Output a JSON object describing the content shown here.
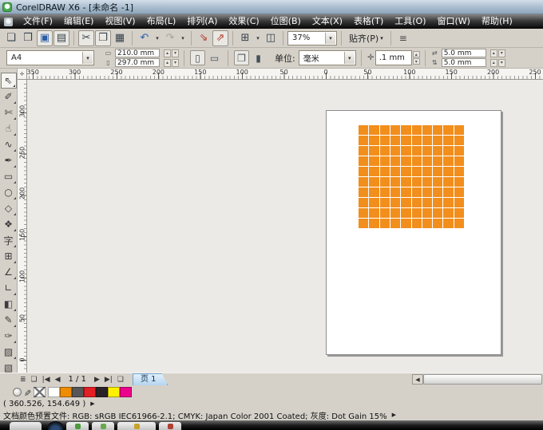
{
  "window": {
    "title": "CorelDRAW X6 - [未命名 -1]"
  },
  "menu": {
    "items": [
      "文件(F)",
      "编辑(E)",
      "视图(V)",
      "布局(L)",
      "排列(A)",
      "效果(C)",
      "位图(B)",
      "文本(X)",
      "表格(T)",
      "工具(O)",
      "窗口(W)",
      "帮助(H)"
    ]
  },
  "toolbar": {
    "new_glyph": "❏",
    "open_glyph": "❒",
    "save_glyph": "▣",
    "print_glyph": "▤",
    "cut_glyph": "✂",
    "copy_glyph": "❐",
    "paste_glyph": "▦",
    "undo_glyph": "↶",
    "redo_glyph": "↷",
    "import_glyph": "⇘",
    "export_glyph": "⇗",
    "launcher_glyph": "⊞",
    "welcome_glyph": "◫",
    "zoom_value": "37%",
    "snap_label": "贴齐(P)",
    "options_glyph": "≡"
  },
  "property_bar": {
    "page_size": "A4",
    "page_width": "210.0 mm",
    "page_height": "297.0 mm",
    "units_label": "单位:",
    "units_value": "毫米",
    "nudge_offset": ".1 mm",
    "duplicate_x": "5.0 mm",
    "duplicate_y": "5.0 mm"
  },
  "glyphs": {
    "spinner_up": "▴",
    "spinner_down": "▾",
    "dropdown": "▾",
    "flyout": "▶",
    "width_icon": "▭",
    "height_icon": "▯",
    "portrait_icon": "▯",
    "landscape_icon": "▭",
    "all_pages_icon": "❐",
    "single_page_icon": "▮",
    "nudge_icon": "✛",
    "dup_x_icon": "⇄",
    "dup_y_icon": "⇅",
    "ruler_origin_icon": "✛",
    "palette_eyedropper_icon": "✐",
    "page_list_icon": "≣",
    "add_page_icon": "❏",
    "first_page_icon": "|◀",
    "prev_page_icon": "◀",
    "next_page_icon": "▶",
    "last_page_icon": "▶|",
    "scroll_left_icon": "◀"
  },
  "rulers": {
    "horizontal_labels": [
      "350",
      "300",
      "250",
      "200",
      "150",
      "100",
      "50",
      "0",
      "50",
      "100",
      "150",
      "200",
      "250"
    ],
    "vertical_labels": [
      "300",
      "250",
      "200",
      "150",
      "100",
      "50",
      "0"
    ]
  },
  "toolbox": {
    "tools": [
      {
        "name": "pick-tool",
        "glyph": "⇖",
        "state": "selected"
      },
      {
        "name": "shape-tool",
        "glyph": "✐"
      },
      {
        "name": "crop-tool",
        "glyph": "✄"
      },
      {
        "name": "zoom-pan-tool",
        "glyph": "☝"
      },
      {
        "name": "freehand-tool",
        "glyph": "∿"
      },
      {
        "name": "smart-fill-tool",
        "glyph": "✒"
      },
      {
        "name": "rectangle-tool",
        "glyph": "▭"
      },
      {
        "name": "ellipse-tool",
        "glyph": "○"
      },
      {
        "name": "polygon-tool",
        "glyph": "◇"
      },
      {
        "name": "basic-shapes-tool",
        "glyph": "❖"
      },
      {
        "name": "text-tool",
        "glyph": "字"
      },
      {
        "name": "table-tool",
        "glyph": "⊞"
      },
      {
        "name": "dimension-tool",
        "glyph": "∠"
      },
      {
        "name": "connector-tool",
        "glyph": "∟"
      },
      {
        "name": "blend-tool",
        "glyph": "◧"
      },
      {
        "name": "color-eyedropper-tool",
        "glyph": "✎"
      },
      {
        "name": "outline-pen-tool",
        "glyph": "✑"
      },
      {
        "name": "fill-tool",
        "glyph": "▨"
      },
      {
        "name": "interactive-fill-tool",
        "glyph": "▧"
      }
    ]
  },
  "canvas": {
    "grid_object": {
      "rows": 10,
      "columns": 10,
      "fill_color": "#F28E1C",
      "line_color": "#FFFFFF"
    }
  },
  "page_nav": {
    "page_indicator": "1 / 1",
    "page_tab": "页 1"
  },
  "palette": {
    "colors": [
      "#FFFFFF",
      "#F08C00",
      "#565656",
      "#E31E24",
      "#2B2226",
      "#FFF100",
      "#EC008C"
    ]
  },
  "status_bar": {
    "coordinates": "( 360.526, 154.649 )",
    "color_profile": "文档颜色预置文件: RGB: sRGB IEC61966-2.1; CMYK: Japan Color 2001 Coated; 灰度: Dot Gain 15%"
  }
}
